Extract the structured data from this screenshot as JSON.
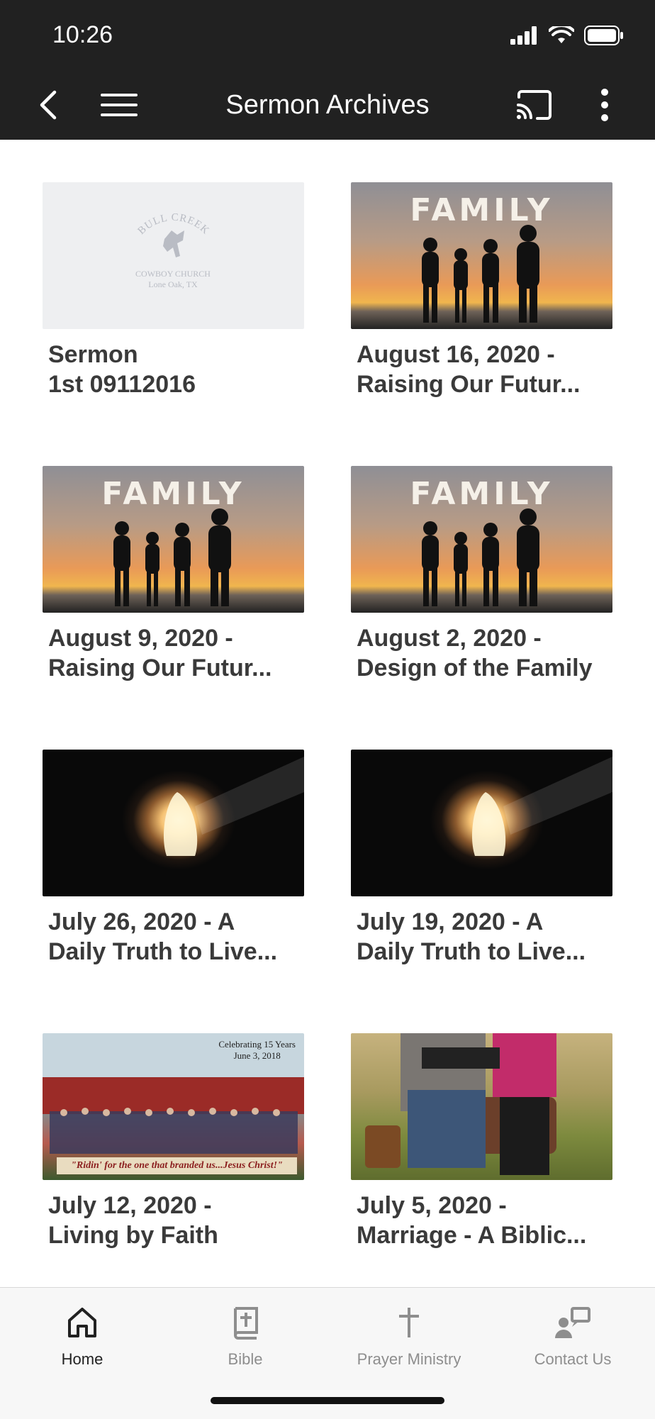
{
  "status_bar": {
    "time": "10:26"
  },
  "app_bar": {
    "title": "Sermon Archives"
  },
  "sermons": [
    {
      "line1": "Sermon",
      "line2": "1st 09112016",
      "thumbnail": "bull-creek-logo"
    },
    {
      "line1": "August 16, 2020 -",
      "line2": "Raising Our Futur...",
      "thumbnail": "family-sunset"
    },
    {
      "line1": "August 9, 2020 -",
      "line2": "Raising Our Futur...",
      "thumbnail": "family-sunset"
    },
    {
      "line1": "August 2, 2020 -",
      "line2": "Design of the Family",
      "thumbnail": "family-sunset"
    },
    {
      "line1": "July 26, 2020 - A",
      "line2": "Daily Truth to Live...",
      "thumbnail": "empty-tomb"
    },
    {
      "line1": "July 19, 2020 - A",
      "line2": "Daily Truth to Live...",
      "thumbnail": "empty-tomb"
    },
    {
      "line1": "July 12, 2020 -",
      "line2": "Living by Faith",
      "thumbnail": "church-anniversary-photo"
    },
    {
      "line1": "July 5, 2020 -",
      "line2": "Marriage - A Biblic...",
      "thumbnail": "couple-reading-bible"
    }
  ],
  "thumbnail_text": {
    "logo_line1": "BULL CREEK",
    "logo_line2": "COWBOY CHURCH",
    "logo_line3": "Lone Oak, TX",
    "family": "FAMILY",
    "church_caption_line1": "Celebrating 15 Years",
    "church_caption_line2": "June 3, 2018",
    "church_banner": "\"Ridin' for the one that branded us...Jesus Christ!\""
  },
  "bottom_nav": [
    {
      "label": "Home",
      "icon": "home-icon",
      "active": true
    },
    {
      "label": "Bible",
      "icon": "bible-icon",
      "active": false
    },
    {
      "label": "Prayer Ministry",
      "icon": "cross-icon",
      "active": false
    },
    {
      "label": "Contact Us",
      "icon": "contact-icon",
      "active": false
    }
  ],
  "colors": {
    "app_bar": "#212121",
    "active_nav": "#222222",
    "inactive_nav": "#8e8e8e"
  }
}
